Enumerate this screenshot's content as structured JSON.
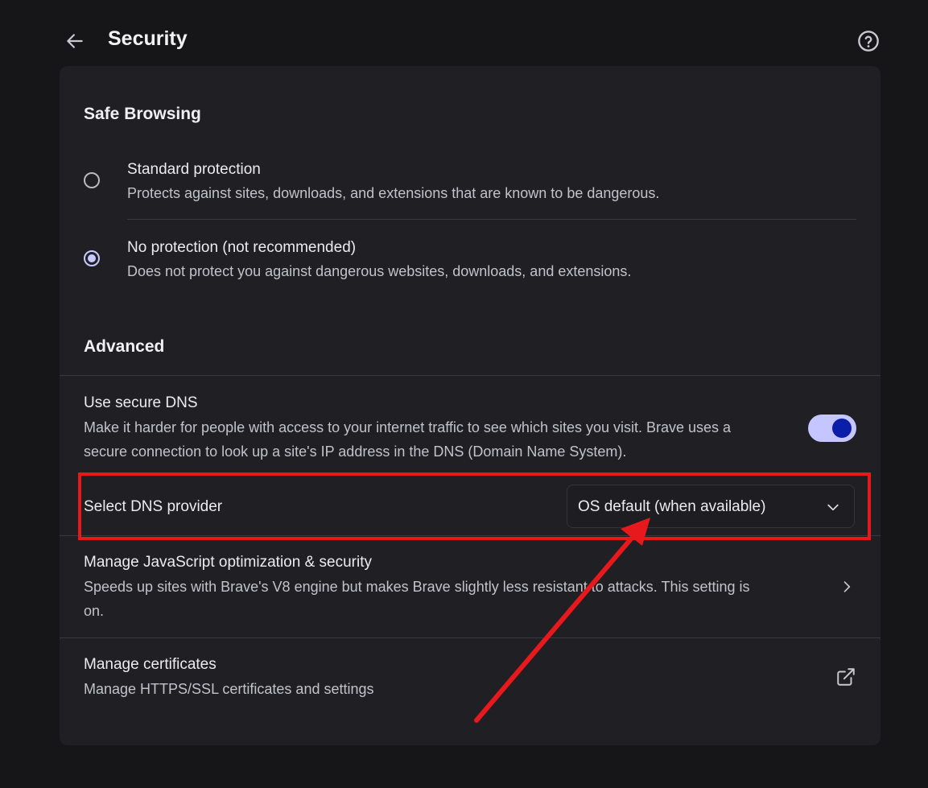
{
  "header": {
    "title": "Security",
    "back_icon": "arrow-left-icon",
    "help_icon": "help-circle-icon"
  },
  "safe_browsing": {
    "title": "Safe Browsing",
    "options": [
      {
        "title": "Standard protection",
        "description": "Protects against sites, downloads, and extensions that are known to be dangerous.",
        "selected": false
      },
      {
        "title": "No protection (not recommended)",
        "description": "Does not protect you against dangerous websites, downloads, and extensions.",
        "selected": true
      }
    ]
  },
  "advanced": {
    "title": "Advanced",
    "secure_dns": {
      "title": "Use secure DNS",
      "description_line1": "Make it harder for people with access to your internet traffic to see which sites you visit. Brave uses a",
      "description_line2": "secure connection to look up a site's IP address in the DNS (Domain Name System).",
      "enabled": true
    },
    "dns_provider": {
      "label": "Select DNS provider",
      "value": "OS default (when available)"
    },
    "javascript": {
      "title": "Manage JavaScript optimization & security",
      "description_line1": "Speeds up sites with Brave's V8 engine but makes Brave slightly less resistant to attacks. This setting is",
      "description_line2": "on."
    },
    "certificates": {
      "title": "Manage certificates",
      "description": "Manage HTTPS/SSL certificates and settings"
    }
  },
  "colors": {
    "accent": "#c5c6ff",
    "toggle_knob": "#0a1ea8",
    "annotation": "#e8191c",
    "background": "#161619",
    "card": "#1f1f24"
  }
}
